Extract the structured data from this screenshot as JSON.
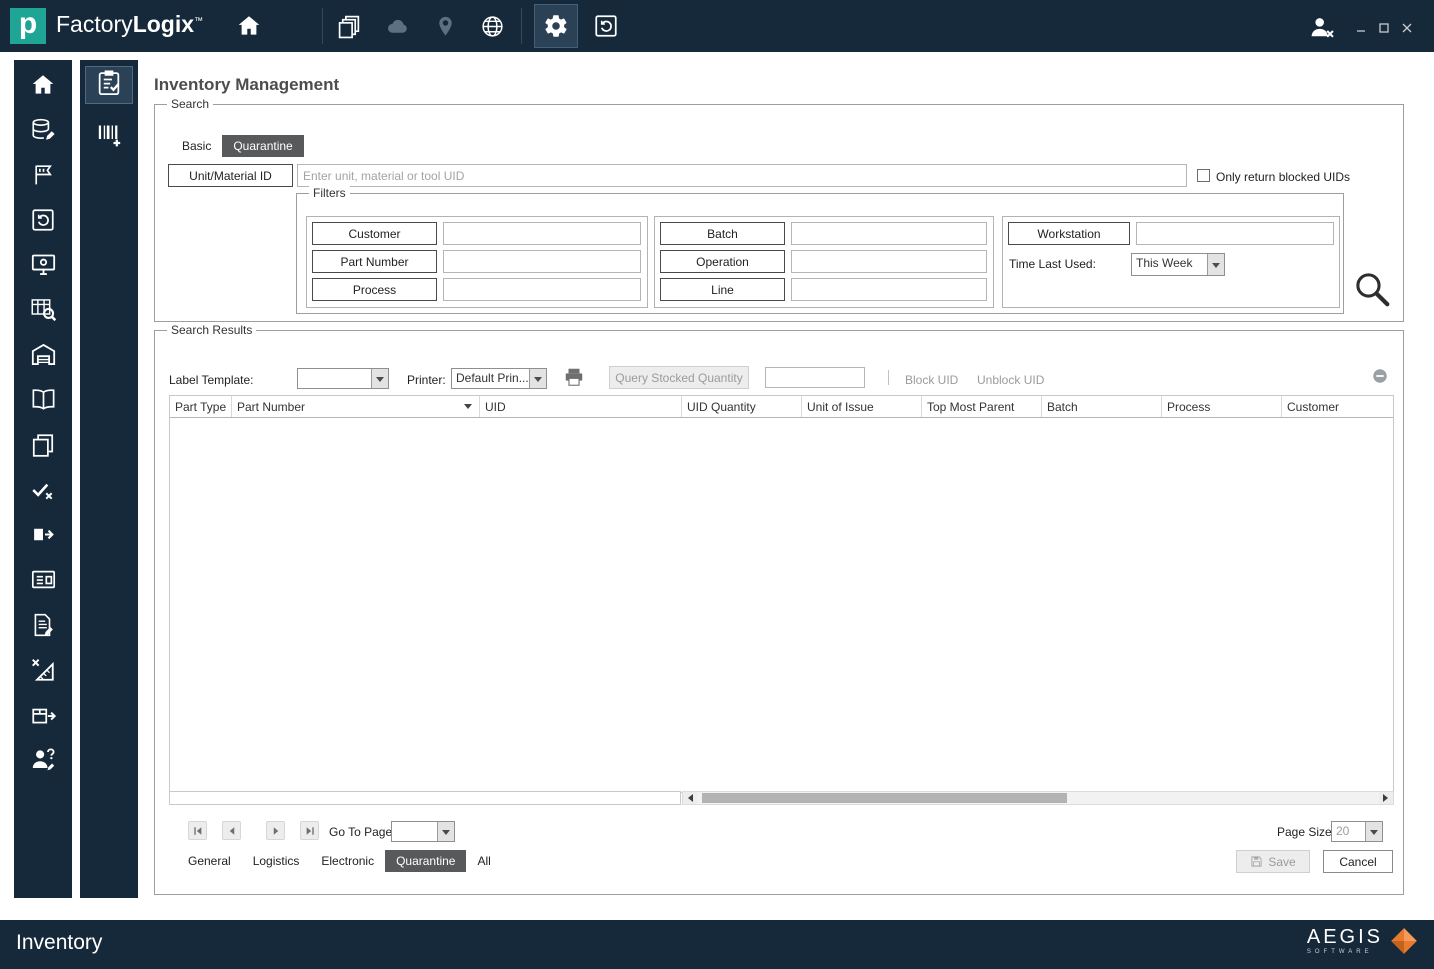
{
  "colors": {
    "titlebar_bg": "#16293a",
    "logo_teal": "#1fa595",
    "selected_tab_bg": "#58595b",
    "brand_orange": "#e87a2f"
  },
  "titlebar": {
    "logo_letter": "p",
    "app_name_part1": "Factory",
    "app_name_part2": "Logix",
    "trademark": "™"
  },
  "page": {
    "title": "Inventory Management"
  },
  "search": {
    "group_label": "Search",
    "tab_basic": "Basic",
    "tab_quarantine": "Quarantine",
    "active_tab": "Quarantine",
    "unit_material_button": "Unit/Material ID",
    "unit_input_value": "",
    "unit_input_placeholder": "Enter unit, material or tool UID",
    "only_blocked_label": "Only return blocked UIDs",
    "only_blocked_checked": false,
    "filters": {
      "group_label": "Filters",
      "customer": "Customer",
      "part_number": "Part Number",
      "process": "Process",
      "batch": "Batch",
      "operation": "Operation",
      "line": "Line",
      "workstation": "Workstation",
      "time_last_used_label": "Time Last Used:",
      "time_last_used_value": "This Week"
    }
  },
  "results": {
    "group_label": "Search Results",
    "label_template": "Label Template:",
    "label_template_value": "",
    "printer_label": "Printer:",
    "printer_value": "Default Prin...",
    "query_stocked_quantity": "Query Stocked Quantity",
    "quantity_input_value": "",
    "block_uid": "Block UID",
    "unblock_uid": "Unblock UID",
    "columns": [
      "Part Type",
      "Part Number",
      "UID",
      "UID Quantity",
      "Unit of Issue",
      "Top Most Parent",
      "Batch",
      "Process",
      "Customer"
    ],
    "sorted_column": "Part Number",
    "rows": [],
    "go_to_page": "Go To Page",
    "go_to_page_value": "",
    "page_size_label": "Page Size",
    "page_size_value": "20",
    "tab_general": "General",
    "tab_logistics": "Logistics",
    "tab_electronic": "Electronic",
    "tab_quarantine": "Quarantine",
    "tab_all": "All",
    "active_tab": "Quarantine",
    "save": "Save",
    "cancel": "Cancel"
  },
  "statusbar": {
    "module_label": "Inventory",
    "brand_name": "AEGIS",
    "brand_subtitle": "SOFTWARE"
  },
  "icons": {
    "titlebar": [
      "home-icon",
      "pages-icon",
      "cloud-icon",
      "location-icon",
      "globe-icon",
      "gear-icon",
      "history-icon",
      "user-block-icon",
      "minimize-icon",
      "maximize-icon",
      "close-icon"
    ],
    "sidebar": [
      "home-icon",
      "database-edit-icon",
      "flag-chart-icon",
      "history-panel-icon",
      "monitor-icon",
      "table-search-icon",
      "warehouse-icon",
      "book-icon",
      "pages-icon",
      "double-check-icon",
      "export-icon",
      "id-card-icon",
      "document-edit-icon",
      "ruler-cancel-icon",
      "package-move-icon",
      "user-question-icon"
    ],
    "sub_sidebar": [
      "clipboard-check-icon",
      "barcode-add-icon"
    ],
    "results": [
      "printer-icon",
      "remove-icon",
      "search-icon",
      "save-icon",
      "first-page-icon",
      "prev-page-icon",
      "next-page-icon",
      "last-page-icon",
      "scroll-left-icon",
      "scroll-right-icon",
      "sort-desc-icon",
      "dropdown-arrow-icon"
    ]
  }
}
